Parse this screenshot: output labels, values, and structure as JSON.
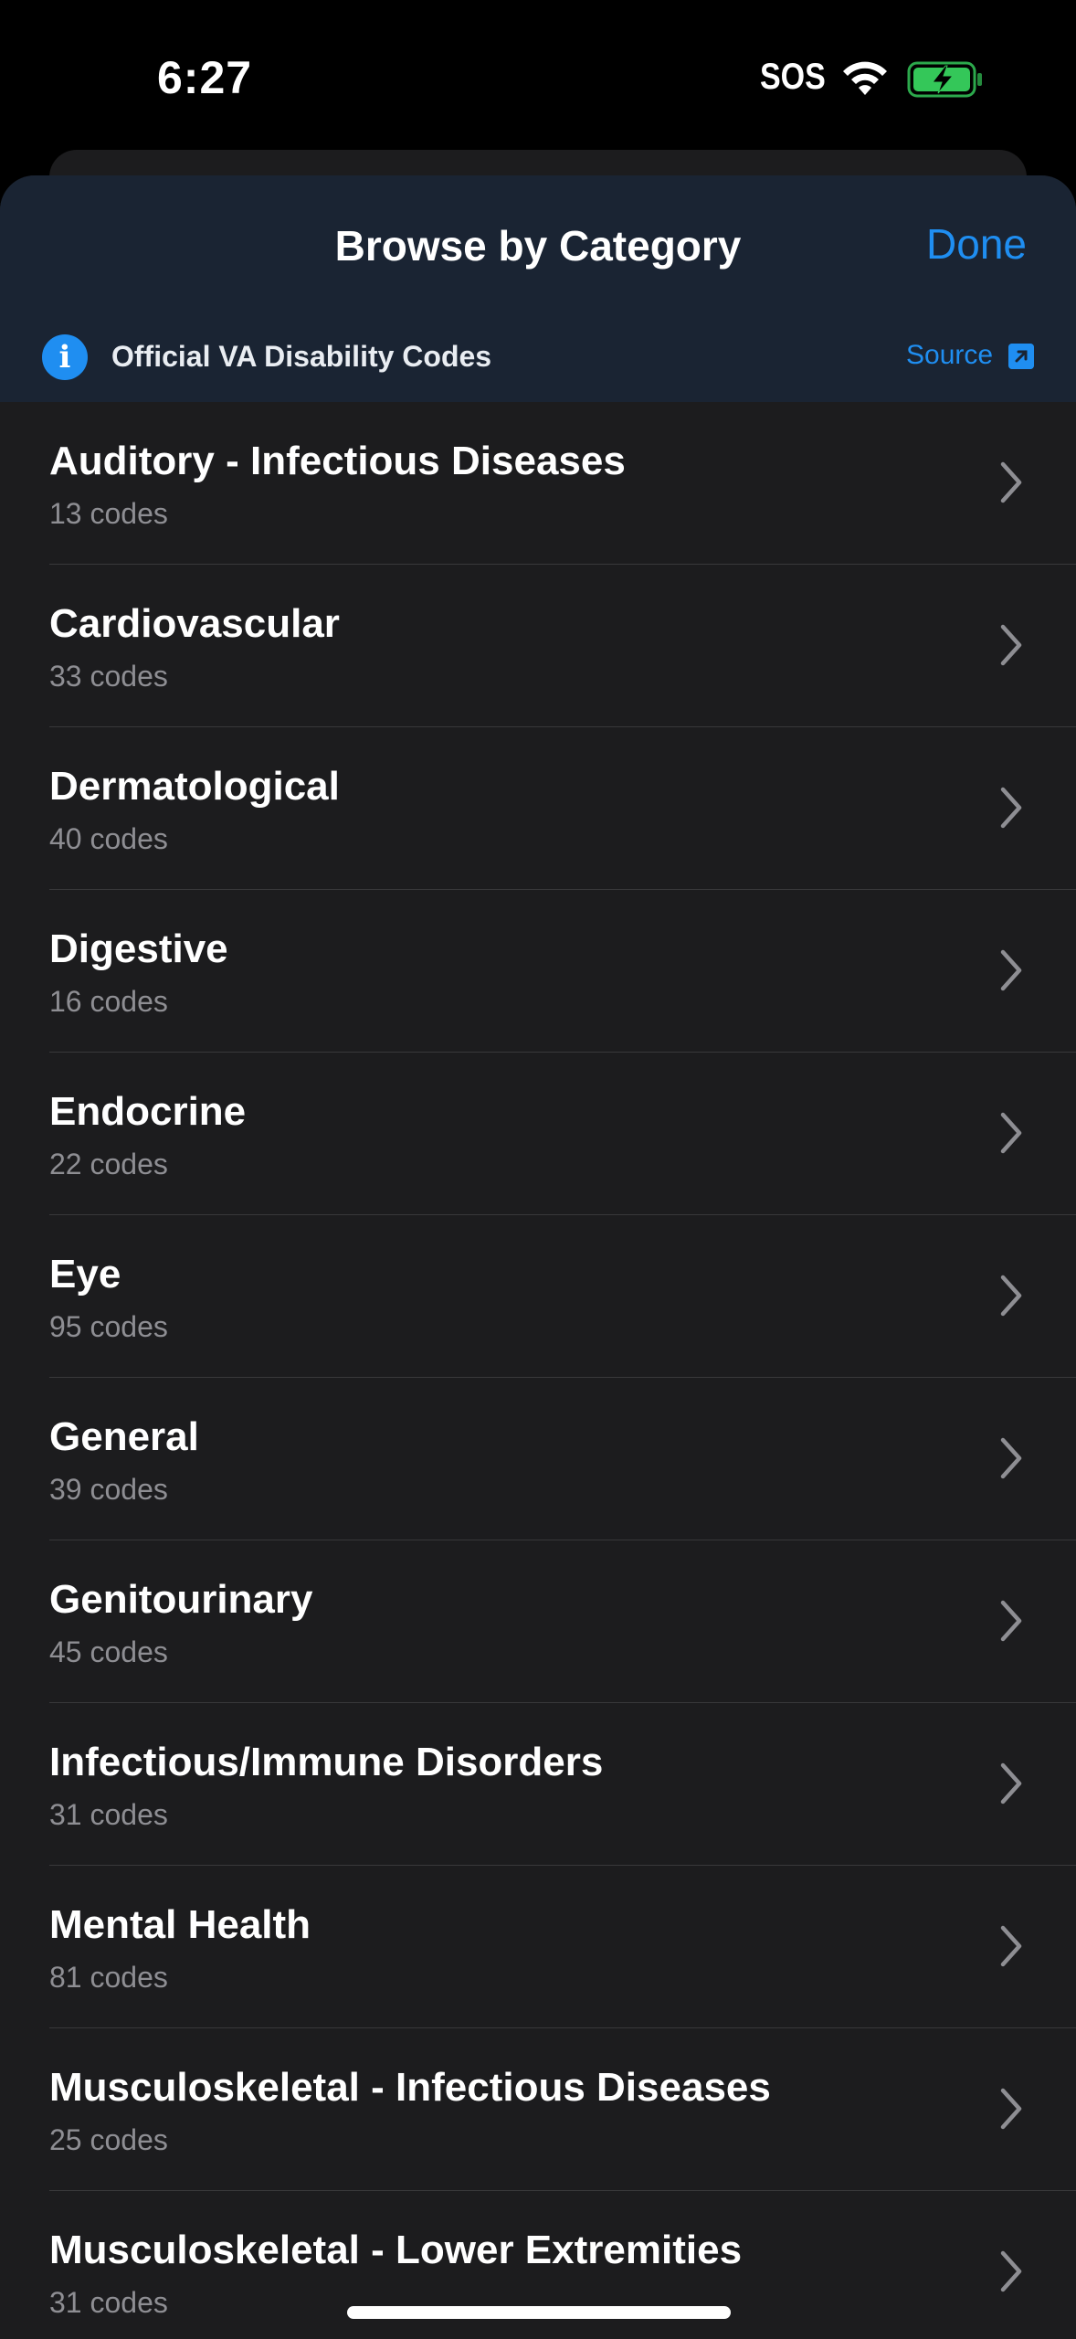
{
  "status_bar": {
    "time": "6:27",
    "sos": "SOS",
    "wifi_icon": "wifi-icon",
    "battery_icon": "battery-charging-icon",
    "battery_color": "#34c759"
  },
  "sheet": {
    "title": "Browse by Category",
    "done_label": "Done",
    "info_banner": {
      "icon": "info-icon",
      "text": "Official VA Disability Codes",
      "source_label": "Source",
      "source_icon": "external-link-icon"
    }
  },
  "categories": [
    {
      "name": "Auditory - Infectious Diseases",
      "count": "13 codes"
    },
    {
      "name": "Cardiovascular",
      "count": "33 codes"
    },
    {
      "name": "Dermatological",
      "count": "40 codes"
    },
    {
      "name": "Digestive",
      "count": "16 codes"
    },
    {
      "name": "Endocrine",
      "count": "22 codes"
    },
    {
      "name": "Eye",
      "count": "95 codes"
    },
    {
      "name": "General",
      "count": "39 codes"
    },
    {
      "name": "Genitourinary",
      "count": "45 codes"
    },
    {
      "name": "Infectious/Immune Disorders",
      "count": "31 codes"
    },
    {
      "name": "Mental Health",
      "count": "81 codes"
    },
    {
      "name": "Musculoskeletal - Infectious Diseases",
      "count": "25 codes"
    },
    {
      "name": "Musculoskeletal - Lower Extremities",
      "count": "31 codes"
    }
  ],
  "colors": {
    "accent": "#1f8ef1",
    "background": "#1c1c1e",
    "header": "#1a2433",
    "secondary_text": "#8e8e93"
  }
}
